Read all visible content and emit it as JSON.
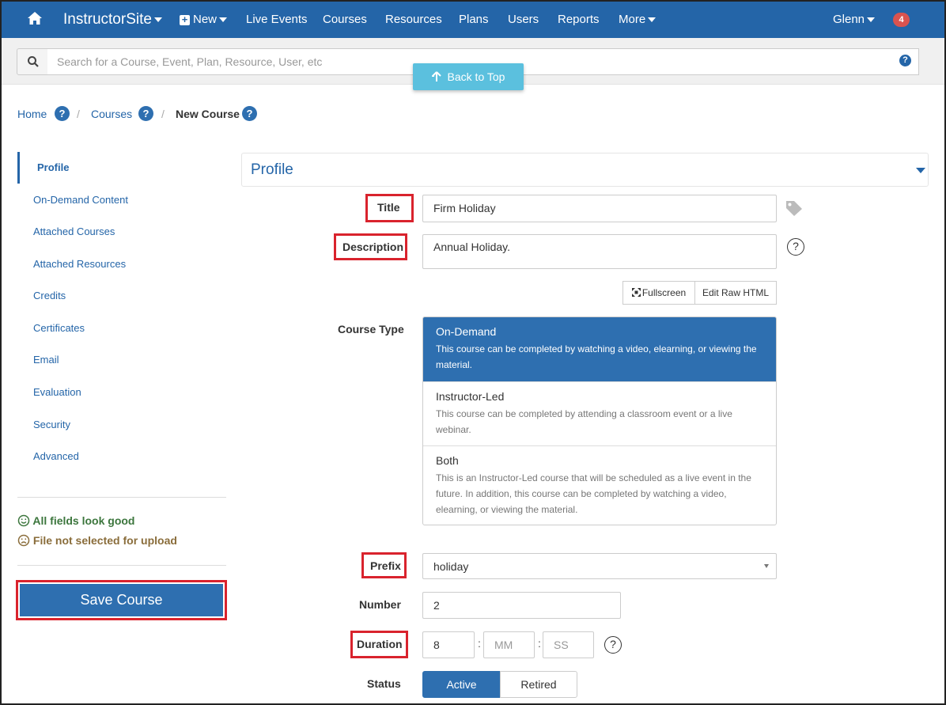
{
  "nav": {
    "brand": "InstructorSite",
    "new_label": "New",
    "items": [
      "Live Events",
      "Courses",
      "Resources",
      "Plans",
      "Users",
      "Reports"
    ],
    "more_label": "More",
    "user": "Glenn",
    "notifications": "4"
  },
  "search": {
    "placeholder": "Search for a Course, Event, Plan, Resource, User, etc",
    "help": "?"
  },
  "back_to_top": "Back to Top",
  "breadcrumb": {
    "home": "Home",
    "courses": "Courses",
    "current": "New Course",
    "sep": "/",
    "help": "?"
  },
  "sidebar": {
    "items": [
      "Profile",
      "On-Demand Content",
      "Attached Courses",
      "Attached Resources",
      "Credits",
      "Certificates",
      "Email",
      "Evaluation",
      "Security",
      "Advanced"
    ],
    "status_good": "All fields look good",
    "status_warn": "File not selected for upload",
    "save_label": "Save Course"
  },
  "panel": {
    "title": "Profile"
  },
  "form": {
    "title_label": "Title",
    "title_value": "Firm Holiday",
    "description_label": "Description",
    "description_value": "Annual Holiday.",
    "fullscreen_label": "Fullscreen",
    "edit_raw_label": "Edit Raw HTML",
    "course_type_label": "Course Type",
    "course_types": [
      {
        "name": "On-Demand",
        "desc": "This course can be completed by watching a video, elearning, or viewing the material.",
        "selected": true
      },
      {
        "name": "Instructor-Led",
        "desc": "This course can be completed by attending a classroom event or a live webinar.",
        "selected": false
      },
      {
        "name": "Both",
        "desc": "This is an Instructor-Led course that will be scheduled as a live event in the future. In addition, this course can be completed by watching a video, elearning, or viewing the material.",
        "selected": false
      }
    ],
    "prefix_label": "Prefix",
    "prefix_value": "holiday",
    "number_label": "Number",
    "number_value": "2",
    "duration_label": "Duration",
    "duration_hours": "8",
    "duration_minutes_placeholder": "MM",
    "duration_seconds_placeholder": "SS",
    "duration_sep": ":",
    "status_label": "Status",
    "status_options": [
      "Active",
      "Retired"
    ],
    "status_selected": "Active",
    "help": "?"
  },
  "colors": {
    "nav_bg": "#2465a8",
    "primary": "#2e6fb0",
    "highlight_box": "#d9232d",
    "back_to_top": "#5bc0de"
  }
}
